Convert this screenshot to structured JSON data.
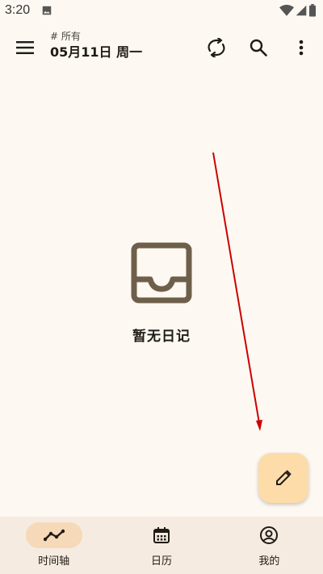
{
  "status_bar": {
    "time": "3:20",
    "icons": [
      "image-icon",
      "wifi-icon",
      "signal-icon",
      "battery-icon"
    ]
  },
  "app_bar": {
    "subtitle": "# 所有",
    "title": "05月11日 周一",
    "icons": {
      "menu": "menu-icon",
      "sync": "sync-icon",
      "search": "search-icon",
      "more": "more-vert-icon"
    }
  },
  "empty_state": {
    "icon": "inbox-icon",
    "text": "暂无日记"
  },
  "fab": {
    "icon": "edit-icon",
    "color": "#fddcaa"
  },
  "bottom_nav": {
    "items": [
      {
        "label": "时间轴",
        "icon": "timeline-icon",
        "active": true
      },
      {
        "label": "日历",
        "icon": "calendar-icon",
        "active": false
      },
      {
        "label": "我的",
        "icon": "account-icon",
        "active": false
      }
    ]
  },
  "colors": {
    "background": "#fdf8f2",
    "nav_background": "#f6ebe0",
    "nav_active_indicator": "#f5d9b8",
    "empty_icon": "#6e5f4b",
    "annotation_arrow": "#cc0000"
  }
}
